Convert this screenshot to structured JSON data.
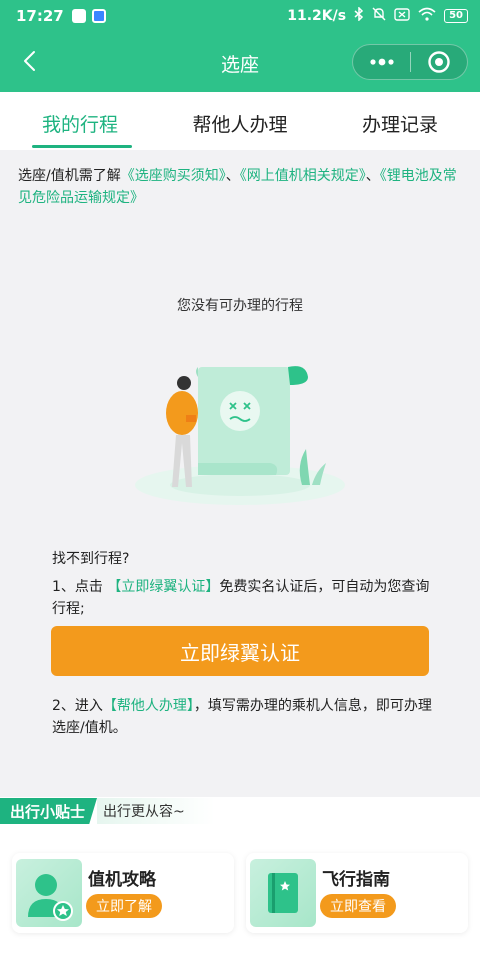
{
  "status_bar": {
    "time": "17:27",
    "network_speed": "11.2K/s",
    "battery": "50"
  },
  "nav": {
    "title": "选座"
  },
  "tabs": [
    {
      "label": "我的行程",
      "active": true
    },
    {
      "label": "帮他人办理",
      "active": false
    },
    {
      "label": "办理记录",
      "active": false
    }
  ],
  "notice": {
    "prefix": "选座/值机需了解",
    "link1": "《选座购买须知》",
    "sep1": "、",
    "link2": "《网上值机相关规定》",
    "sep2": "、",
    "link3": "《锂电池及常见危险品运输规定》"
  },
  "empty": {
    "message": "您没有可办理的行程"
  },
  "help": {
    "question": "找不到行程?",
    "step1_prefix": "1、点击",
    "step1_link": "【立即绿翼认证】",
    "step1_suffix": "免费实名认证后，可自动为您查询行程;",
    "verify_button": "立即绿翼认证",
    "step2_prefix": "2、进入",
    "step2_link": "【帮他人办理】",
    "step2_suffix": "，填写需办理的乘机人信息，即可办理选座/值机。"
  },
  "tips": {
    "badge": "出行小贴士",
    "subtitle": "出行更从容~",
    "cards": [
      {
        "title": "值机攻略",
        "button": "立即了解",
        "icon": "person-star-icon"
      },
      {
        "title": "飞行指南",
        "button": "立即查看",
        "icon": "guide-book-icon"
      }
    ]
  },
  "colors": {
    "brand_green": "#2ec28a",
    "accent_green": "#1eb380",
    "orange": "#f39a1c"
  }
}
